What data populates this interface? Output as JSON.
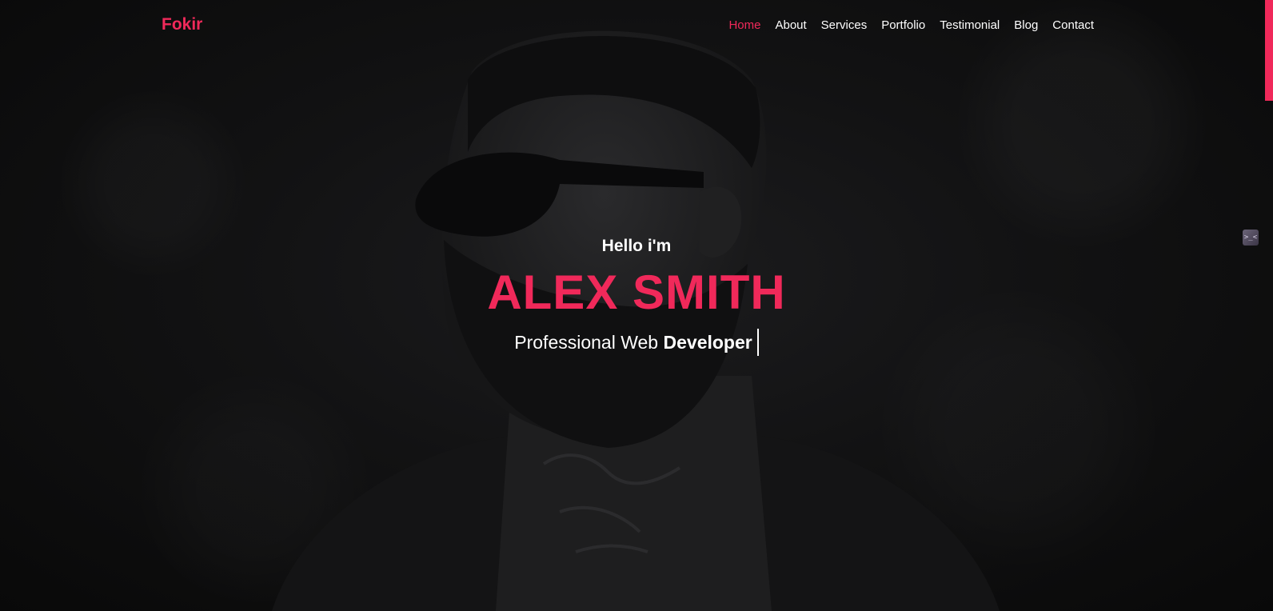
{
  "header": {
    "brand": "Fokir",
    "nav": [
      {
        "label": "Home",
        "active": true
      },
      {
        "label": "About",
        "active": false
      },
      {
        "label": "Services",
        "active": false
      },
      {
        "label": "Portfolio",
        "active": false
      },
      {
        "label": "Testimonial",
        "active": false
      },
      {
        "label": "Blog",
        "active": false
      },
      {
        "label": "Contact",
        "active": false
      }
    ]
  },
  "hero": {
    "greeting": "Hello i'm",
    "name": "ALEX SMITH",
    "subtitle_prefix": "Professional Web ",
    "subtitle_highlight": "Developer"
  },
  "side_widget": {
    "icon": "terminal-icon",
    "glyph": ">_<"
  },
  "colors": {
    "accent": "#f0295a",
    "text": "#ffffff",
    "background": "#0b0b0c"
  }
}
